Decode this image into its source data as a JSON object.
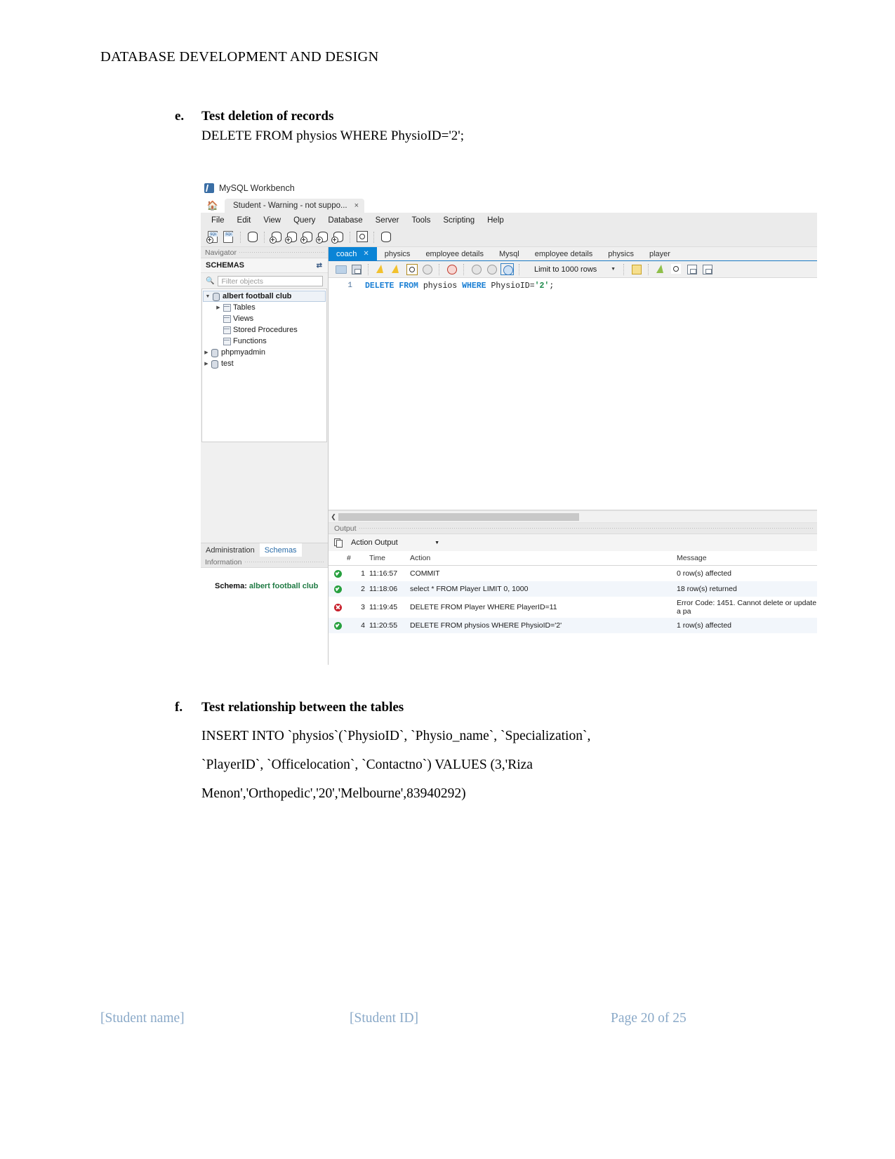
{
  "document": {
    "header": "DATABASE DEVELOPMENT AND DESIGN",
    "item_e": {
      "letter": "e.",
      "title": "Test deletion of records",
      "body": "DELETE FROM physios WHERE PhysioID='2';"
    },
    "item_f": {
      "letter": "f.",
      "title": "Test relationship between the tables",
      "line1": "INSERT INTO `physios`(`PhysioID`, `Physio_name`, `Specialization`,",
      "line2": "`PlayerID`, `Officelocation`, `Contactno`) VALUES (3,'Riza",
      "line3": "Menon','Orthopedic','20','Melbourne',83940292)"
    },
    "footer": {
      "student_name": "[Student name]",
      "student_id": "[Student ID]",
      "page": "Page 20 of 25"
    }
  },
  "workbench": {
    "app_title": "MySQL Workbench",
    "connection_tab": "Student - Warning - not suppo...",
    "connection_tab_close": "×",
    "menu": [
      "File",
      "Edit",
      "View",
      "Query",
      "Database",
      "Server",
      "Tools",
      "Scripting",
      "Help"
    ],
    "navigator": {
      "panel_label": "Navigator",
      "section_label": "SCHEMAS",
      "filter_placeholder": "Filter objects",
      "tree": [
        {
          "label": "albert football club",
          "level": 0,
          "expanded": true,
          "selected": true,
          "bold": true
        },
        {
          "label": "Tables",
          "level": 1,
          "expanded": false,
          "selected": false,
          "bold": false
        },
        {
          "label": "Views",
          "level": 1,
          "expanded": null,
          "selected": false,
          "bold": false
        },
        {
          "label": "Stored Procedures",
          "level": 1,
          "expanded": null,
          "selected": false,
          "bold": false
        },
        {
          "label": "Functions",
          "level": 1,
          "expanded": null,
          "selected": false,
          "bold": false
        },
        {
          "label": "phpmyadmin",
          "level": 0,
          "expanded": false,
          "selected": false,
          "bold": false
        },
        {
          "label": "test",
          "level": 0,
          "expanded": false,
          "selected": false,
          "bold": false
        }
      ],
      "bottom_tabs": [
        {
          "label": "Administration",
          "active": false
        },
        {
          "label": "Schemas",
          "active": true
        }
      ],
      "information_label": "Information",
      "info_schema_prefix": "Schema:",
      "info_schema_name": "albert football club"
    },
    "query_tabs": [
      {
        "label": "coach",
        "active": true,
        "closable": true
      },
      {
        "label": "physics",
        "active": false,
        "closable": false
      },
      {
        "label": "employee details",
        "active": false,
        "closable": false
      },
      {
        "label": "Mysql",
        "active": false,
        "closable": false
      },
      {
        "label": "employee details",
        "active": false,
        "closable": false
      },
      {
        "label": "physics",
        "active": false,
        "closable": false
      },
      {
        "label": "player",
        "active": false,
        "closable": false
      }
    ],
    "query_toolbar": {
      "limit_label": "Limit to 1000 rows",
      "icons": [
        "open-folder-icon",
        "save-icon",
        "execute-icon",
        "execute-current-icon",
        "explain-icon",
        "stop-icon",
        "toggle-breakpoint-icon",
        "commit-icon",
        "rollback-icon",
        "autocommit-icon",
        "beautify-icon",
        "find-icon",
        "formatting-icon",
        "wrap-icon"
      ]
    },
    "editor": {
      "line_number": "1",
      "tokens": [
        {
          "text": "DELETE",
          "kind": "keyword"
        },
        {
          "text": "FROM",
          "kind": "keyword"
        },
        {
          "text": "physios",
          "kind": "identifier"
        },
        {
          "text": "WHERE",
          "kind": "keyword"
        },
        {
          "text": "PhysioID=",
          "kind": "identifier"
        },
        {
          "text": "'2'",
          "kind": "string"
        },
        {
          "text": ";",
          "kind": "identifier"
        }
      ]
    },
    "output": {
      "panel_label": "Output",
      "selector_value": "Action Output",
      "columns": [
        "#",
        "Time",
        "Action",
        "Message"
      ],
      "rows": [
        {
          "status": "ok",
          "n": "1",
          "time": "11:16:57",
          "action": "COMMIT",
          "message": "0 row(s) affected"
        },
        {
          "status": "ok",
          "n": "2",
          "time": "11:18:06",
          "action": "select * FROM Player LIMIT 0, 1000",
          "message": "18 row(s) returned"
        },
        {
          "status": "error",
          "n": "3",
          "time": "11:19:45",
          "action": "DELETE FROM Player WHERE PlayerID=11",
          "message": "Error Code: 1451. Cannot delete or update a pa"
        },
        {
          "status": "ok",
          "n": "4",
          "time": "11:20:55",
          "action": "DELETE FROM physios WHERE PhysioID='2'",
          "message": "1 row(s) affected"
        }
      ]
    }
  },
  "colors": {
    "tab_active": "#0a84d6",
    "link_blue": "#8aa9c8",
    "schema_green": "#1f7a43",
    "ok_green": "#27a03f",
    "error_red": "#c8202c"
  }
}
